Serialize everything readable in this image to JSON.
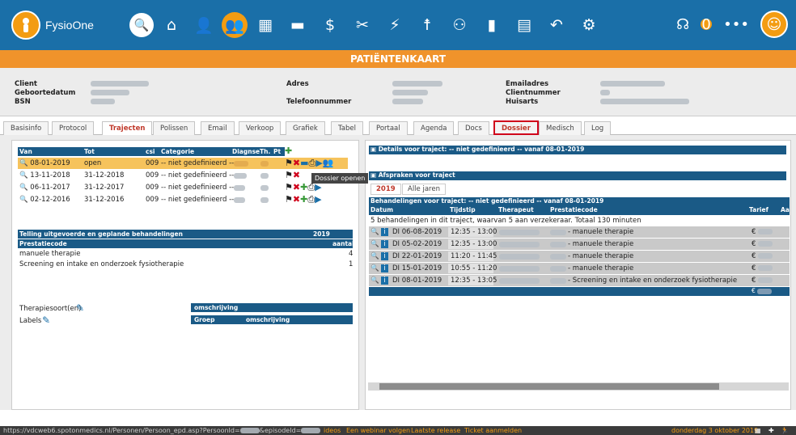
{
  "app": {
    "name": "FysioOne"
  },
  "header": {
    "badge_count": "0"
  },
  "title": "PATIËNTENKAART",
  "patient": {
    "client": "Client",
    "geboortedatum": "Geboortedatum",
    "bsn": "BSN",
    "adres": "Adres",
    "telefoon": "Telefoonnummer",
    "email": "Emailadres",
    "clientnummer": "Clientnummer",
    "huisarts": "Huisarts"
  },
  "tabs": [
    "Basisinfo",
    "Protocol",
    "Trajecten",
    "Polissen",
    "Email",
    "Verkoop",
    "Grafiek",
    "Tabel",
    "Portaal",
    "Agenda",
    "Docs",
    "Dossier",
    "Medisch",
    "Log"
  ],
  "trajecten": {
    "headers": {
      "van": "Van",
      "tot": "Tot",
      "csi": "csi",
      "categorie": "Categorie",
      "diagnose": "Diagnse",
      "th": "Th.",
      "pt": "Pt"
    },
    "rows": [
      {
        "van": "08-01-2019",
        "tot": "open",
        "csi": "009",
        "cat": "-- niet gedefinieerd --"
      },
      {
        "van": "13-11-2018",
        "tot": "31-12-2018",
        "csi": "009",
        "cat": "-- niet gedefinieerd --"
      },
      {
        "van": "06-11-2017",
        "tot": "31-12-2017",
        "csi": "009",
        "cat": "-- niet gedefinieerd --"
      },
      {
        "van": "02-12-2016",
        "tot": "31-12-2016",
        "csi": "009",
        "cat": "-- niet gedefinieerd --"
      }
    ],
    "tooltip": "Dossier openen"
  },
  "telling": {
    "title": "Telling uitgevoerde en geplande behandelingen",
    "year": "2019",
    "col1": "Prestatiecode",
    "col2": "aantal",
    "rows": [
      {
        "code": "manuele therapie",
        "count": "4"
      },
      {
        "code": "Screening en intake en onderzoek fysiotherapie",
        "count": "1"
      }
    ]
  },
  "therapie": {
    "label": "Therapiesoort(en)",
    "col": "omschrijving",
    "labels": "Labels",
    "groep": "Groep",
    "omschr": "omschrijving"
  },
  "details": {
    "title": "Details voor traject: -- niet gedefinieerd -- vanaf 08-01-2019",
    "afspraken": "Afspraken voor traject",
    "tab_year": "2019",
    "tab_all": "Alle jaren",
    "beh_title": "Behandelingen voor traject: -- niet gedefinieerd -- vanaf 08-01-2019",
    "cols": {
      "datum": "Datum",
      "tijd": "Tijdstip",
      "ther": "Therapeut",
      "code": "Prestatiecode",
      "tarief": "Tarief",
      "a": "Aa"
    },
    "summary": "5 behandelingen in dit traject, waarvan 5 aan verzekeraar. Totaal 130 minuten",
    "rows": [
      {
        "datum": "DI 06-08-2019",
        "tijd": "12:35 - 13:00",
        "code": "- manuele therapie"
      },
      {
        "datum": "DI 05-02-2019",
        "tijd": "12:35 - 13:00",
        "code": "- manuele therapie"
      },
      {
        "datum": "DI 22-01-2019",
        "tijd": "11:20 - 11:45",
        "code": "- manuele therapie"
      },
      {
        "datum": "DI 15-01-2019",
        "tijd": "10:55 - 11:20",
        "code": "- manuele therapie"
      },
      {
        "datum": "DI 08-01-2019",
        "tijd": "12:35 - 13:05",
        "code": "- Screening en intake en onderzoek fysiotherapie"
      }
    ],
    "currency": "€"
  },
  "footer": {
    "url": "https://vdcweb6.spotonmedics.nl/Personen/Persoon_epd.asp?PersoonId=",
    "url2": "&episodeId=",
    "link1": "ideos",
    "link2": "Een webinar volgen",
    "link3": "Laatste release",
    "link4": "Ticket aanmelden",
    "date": "donderdag 3 oktober 2019"
  }
}
